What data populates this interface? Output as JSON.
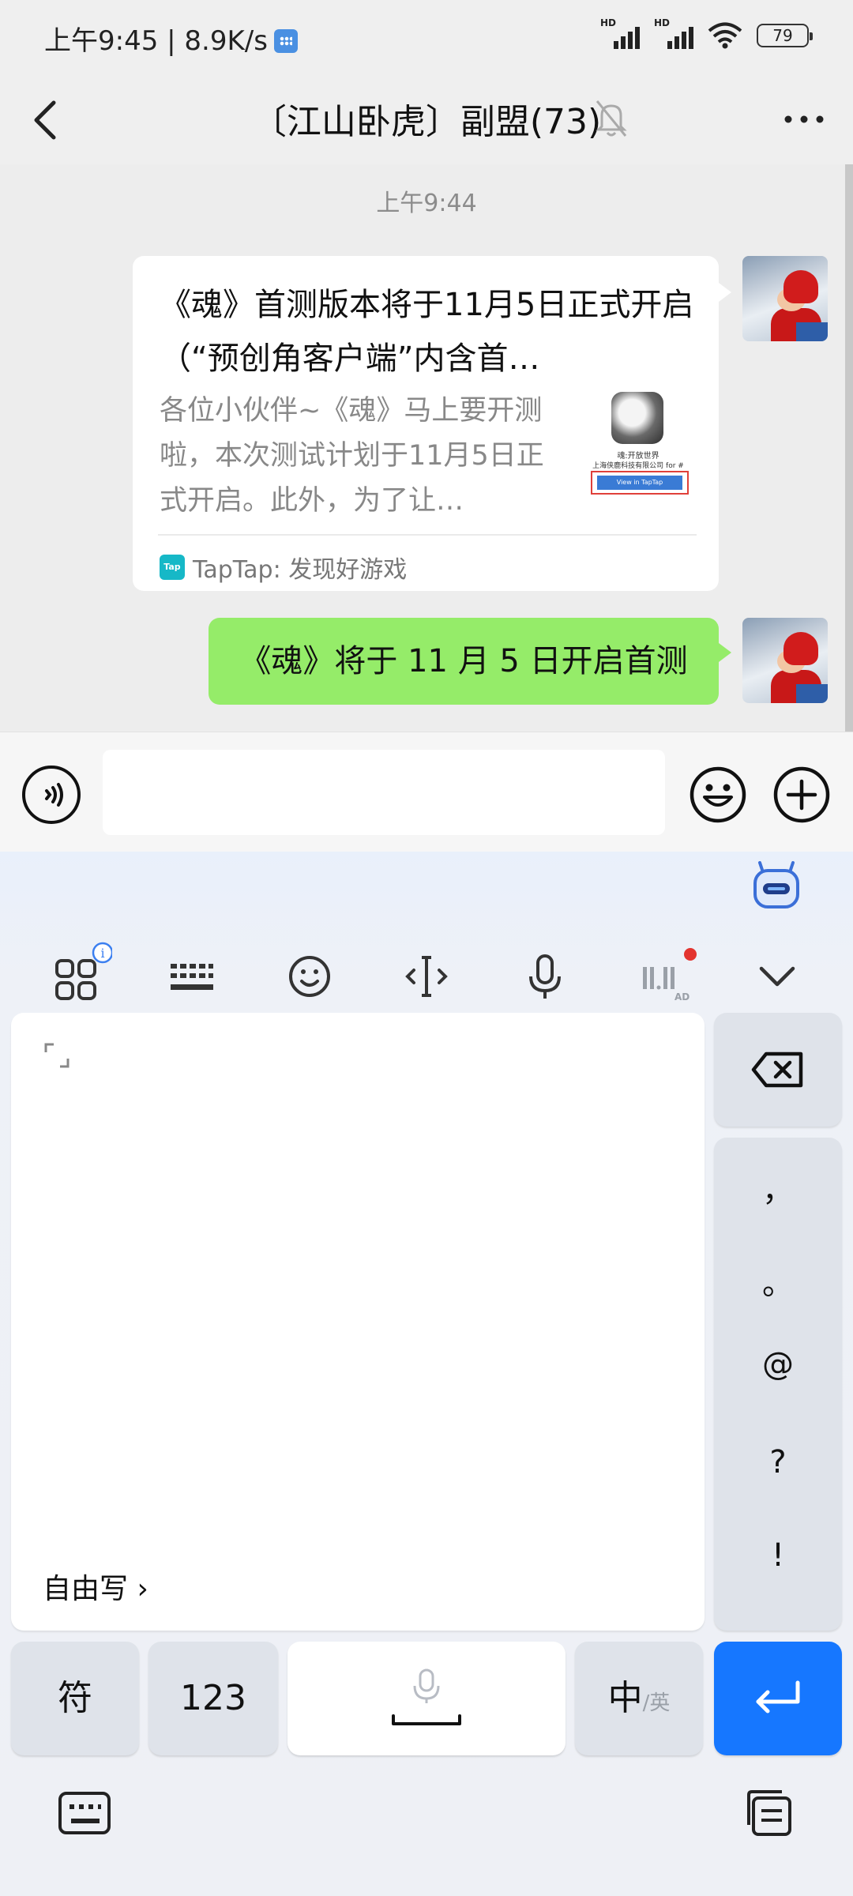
{
  "status_bar": {
    "time": "上午9:45 | 8.9K/s",
    "signal1": "HD",
    "signal2": "HD",
    "battery": "79"
  },
  "header": {
    "title": "〔江山卧虎〕副盟(73)"
  },
  "chat": {
    "timestamp": "上午9:44",
    "messages": [
      {
        "type": "link-card",
        "title": "《魂》首测版本将于11月5日正式开启（“预创角客户端”内含首…",
        "description": "各位小伙伴~《魂》马上要开测啦，本次测试计划于11月5日正式开启。此外，为了让…",
        "thumb_line1": "魂:开放世界",
        "thumb_line2": "上海侠鹿科技有限公司 for #",
        "thumb_button": "View in TapTap",
        "source_badge": "Tap",
        "source": "TapTap: 发现好游戏"
      },
      {
        "type": "text",
        "text": "《魂》将于 11 月 5 日开启首测"
      }
    ]
  },
  "input": {
    "value": ""
  },
  "keyboard": {
    "ad_label": "AD",
    "free_write": "自由写 ›",
    "punctuation": [
      "，",
      "。",
      "@",
      "?",
      "!"
    ],
    "keys": {
      "symbols": "符",
      "numbers": "123",
      "lang_main": "中",
      "lang_alt": "/英"
    }
  },
  "colors": {
    "accent_blue": "#1677ff",
    "bubble_green": "#95ec69"
  }
}
